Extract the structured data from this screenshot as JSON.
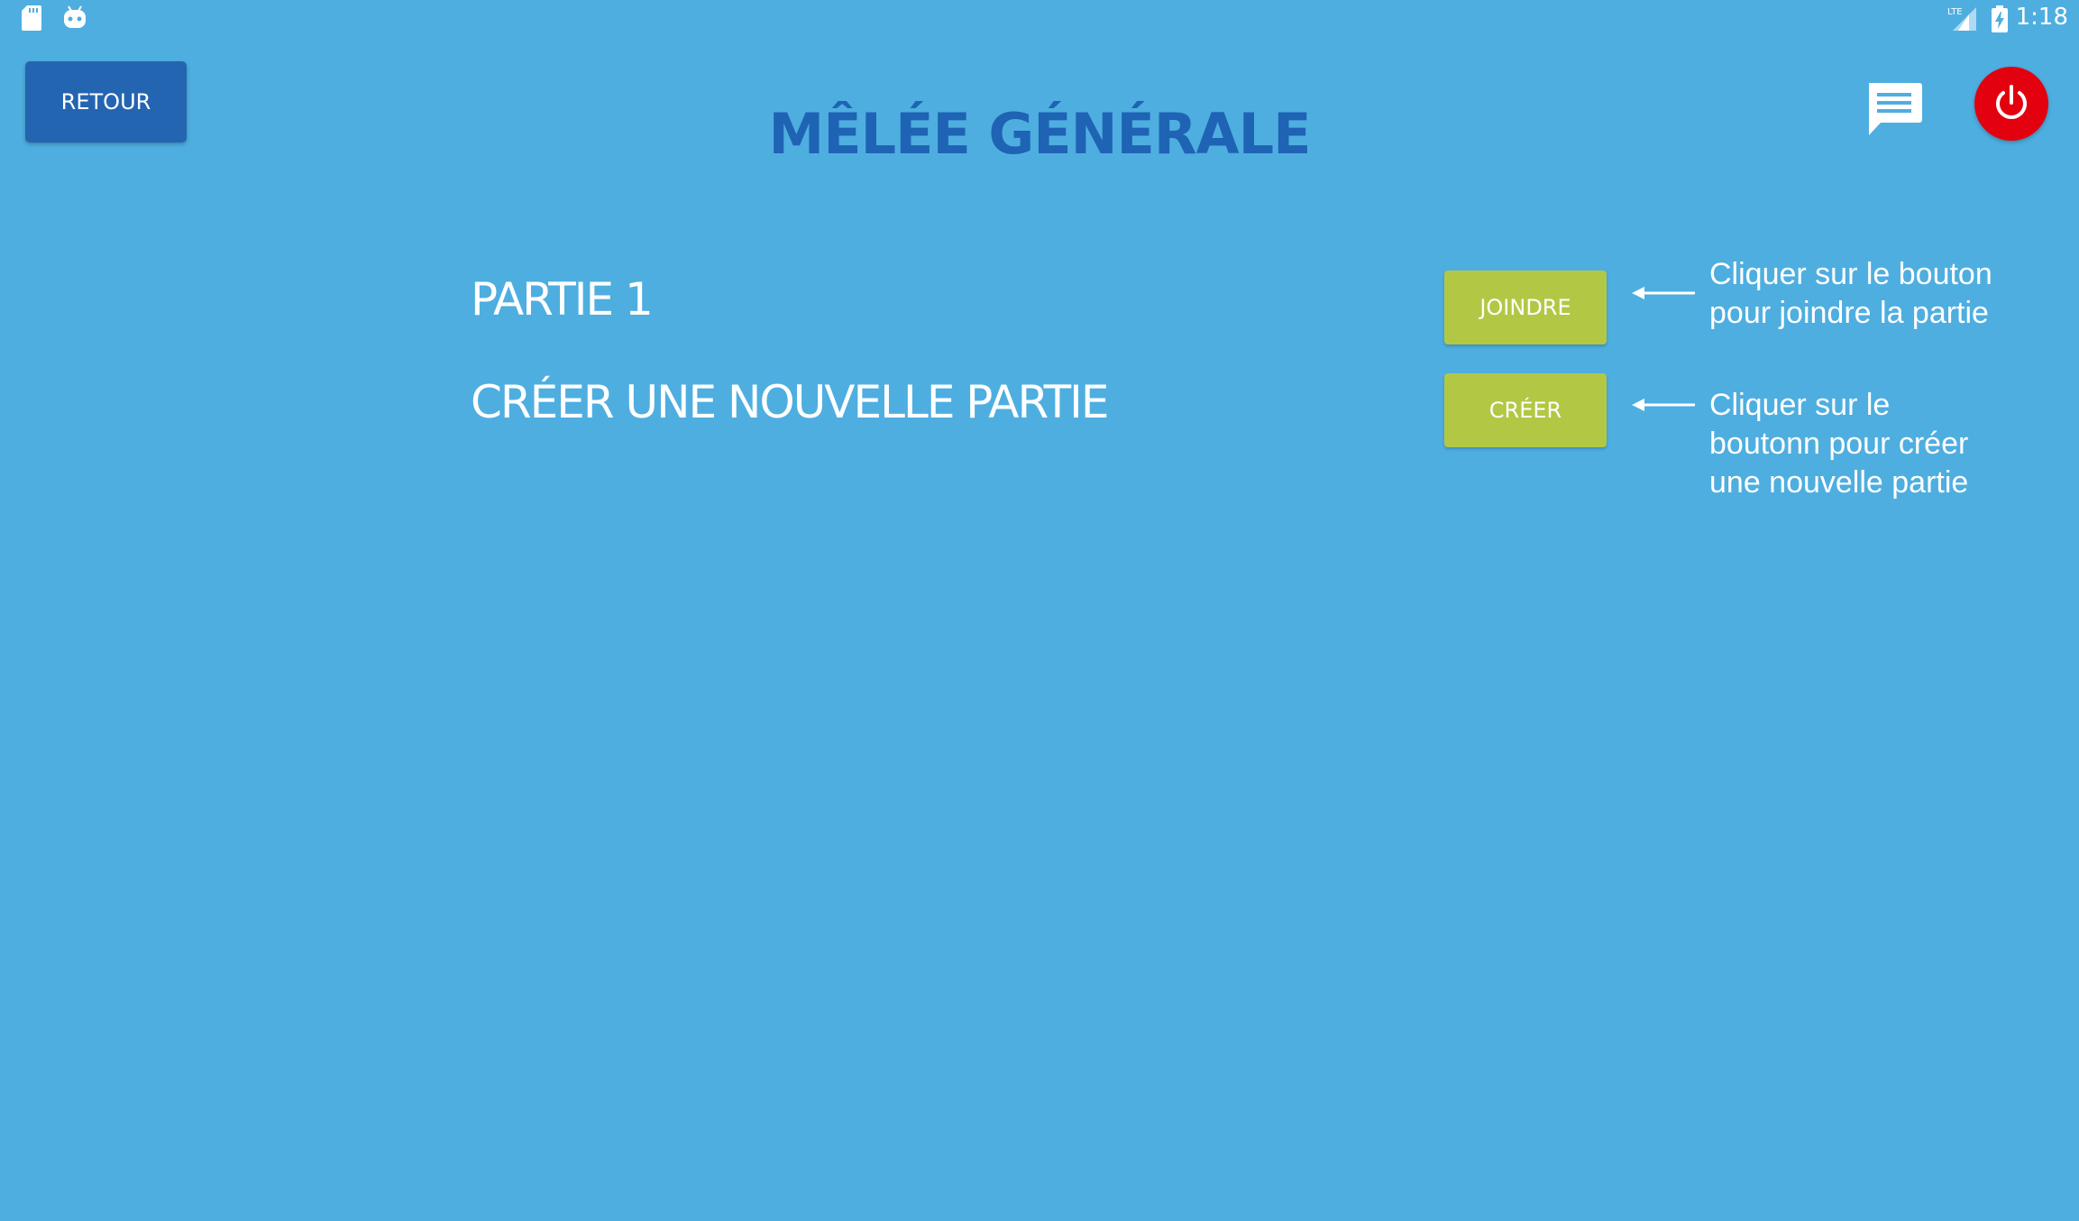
{
  "status_bar": {
    "left_icons": [
      "sd-card-icon",
      "android-icon"
    ],
    "right_icons": [
      "lte-signal-icon",
      "battery-charging-icon"
    ],
    "network_label": "LTE",
    "time": "1:18"
  },
  "header": {
    "back_label": "RETOUR",
    "title": "MÊLÉE GÉNÉRALE",
    "chat_icon": "chat-icon",
    "power_icon": "power-icon"
  },
  "rows": [
    {
      "label": "PARTIE 1",
      "button": "JOINDRE",
      "hint": [
        "Cliquer sur le bouton",
        "pour joindre la partie"
      ]
    },
    {
      "label": "CRÉER UNE NOUVELLE PARTIE",
      "button": "CRÉER",
      "hint": [
        "Cliquer sur le",
        "boutonn pour créer",
        "une nouvelle partie"
      ]
    }
  ],
  "colors": {
    "background": "#4eaee0",
    "back_button": "#2465b1",
    "title": "#1f63b4",
    "action_button": "#b2c845",
    "power_button": "#e3000f"
  }
}
